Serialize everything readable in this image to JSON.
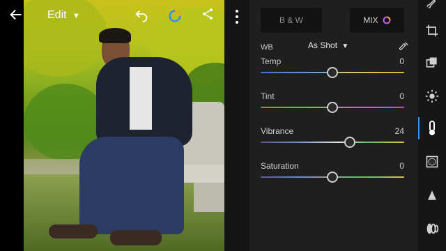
{
  "topbar": {
    "edit_label": "Edit"
  },
  "panel": {
    "mode_bw_label": "B & W",
    "mode_mix_label": "MIX",
    "wb": {
      "label": "WB",
      "value": "As Shot"
    },
    "sliders": [
      {
        "label": "Temp",
        "value": "0",
        "level": 0.5
      },
      {
        "label": "Tint",
        "value": "0",
        "level": 0.5
      },
      {
        "label": "Vibrance",
        "value": "24",
        "level": 0.62
      },
      {
        "label": "Saturation",
        "value": "0",
        "level": 0.5
      }
    ]
  },
  "colors": {
    "accent": "#3c8ff0",
    "panel_bg": "#1f1f1f"
  },
  "icons": {
    "back": "arrow-left-icon",
    "edit_dropdown": "chevron-down-icon",
    "undo": "undo-icon",
    "profile_ring": "color-ring-icon",
    "share": "share-icon",
    "more": "more-vertical-icon",
    "eyedropper": "eyedropper-icon",
    "rail": [
      "brush-icon",
      "crop-icon",
      "presets-icon",
      "light-icon",
      "color-temp-icon",
      "vignette-icon",
      "detail-icon",
      "optics-icon"
    ]
  }
}
